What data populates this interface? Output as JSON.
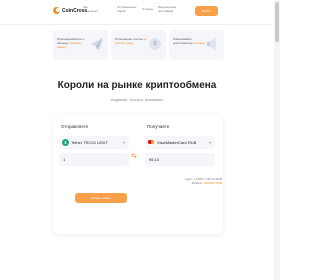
{
  "nav": {
    "brand": "CoinCross",
    "links": [
      {
        "line1": "Как",
        "line2": "обменять?"
      },
      {
        "line1": "Оптимальные",
        "line2": "биржи"
      },
      {
        "line1": "Отзывы",
        "line2": ""
      },
      {
        "line1": "Партнерская",
        "line2": "программа"
      }
    ],
    "cta": "Войти"
  },
  "promos": [
    {
      "text_plain": "Присоединяйтесь к нашему",
      "text_highlight": "Telegram-каналу",
      "art_icon": "paper-plane-icon"
    },
    {
      "text_plain": "Пополнение счетов",
      "text_highlight": "на любой сумму",
      "art_icon": "usdt-coin-icon"
    },
    {
      "text_plain": "Обменивайте криптовалюту",
      "text_highlight": "выгодно",
      "art_icon": "megaphone-icon"
    }
  ],
  "hero": {
    "title": "Короли на рынке криптообмена",
    "subtitle": "Надежно, быстро, анонимно"
  },
  "exchange": {
    "send_label": "Отправляете",
    "receive_label": "Получаете",
    "send_currency": "Tether TRC20 USDT",
    "receive_currency": "Visa/MasterCard RUB",
    "send_amount": "1",
    "receive_amount": "95.13",
    "rate_line": "Курс: 1 USDT = 95.13 RUB",
    "reserve_prefix": "Резерв:",
    "reserve_value": "1000000 RUB",
    "submit": "Начать обмен"
  },
  "colors": {
    "accent": "#f28c28",
    "accent_button": "#f6a04a",
    "tether": "#26a17b"
  }
}
